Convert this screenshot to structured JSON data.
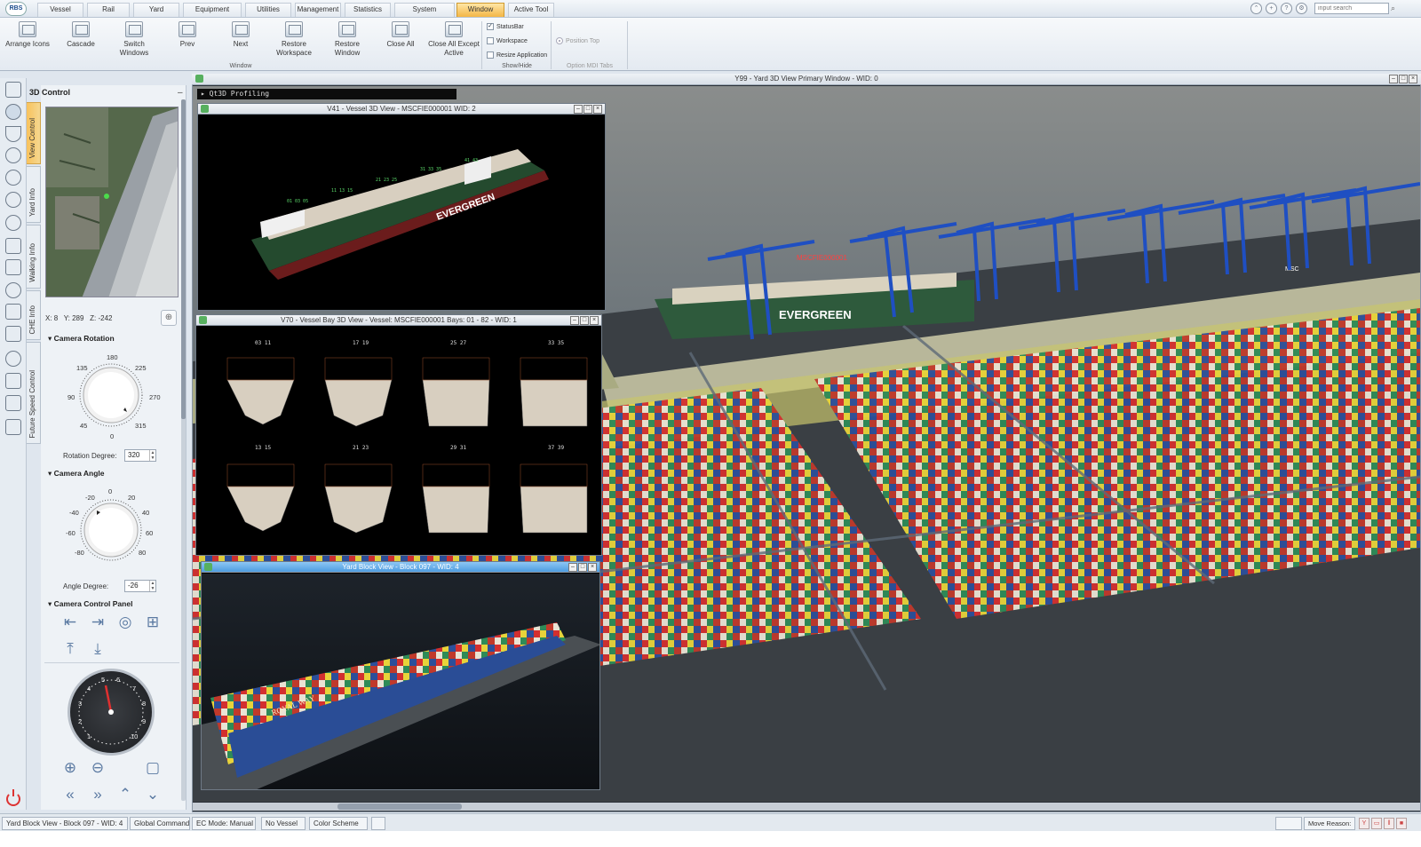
{
  "menu": {
    "logo": "RBS",
    "tabs": [
      "Vessel",
      "Rail",
      "Yard",
      "Equipment Control",
      "Utilities",
      "Management",
      "Statistics",
      "System References",
      "Window",
      "Active Tool"
    ],
    "active_tab": "Window",
    "search_placeholder": "input search"
  },
  "ribbon": {
    "buttons": [
      {
        "label": "Arrange Icons"
      },
      {
        "label": "Cascade"
      },
      {
        "label": "Switch Windows"
      },
      {
        "label": "Prev"
      },
      {
        "label": "Next"
      },
      {
        "label": "Restore Workspace"
      },
      {
        "label": "Restore Window"
      },
      {
        "label": "Close All"
      },
      {
        "label": "Close All Except Active"
      }
    ],
    "window_group_label": "Window",
    "show_hide": {
      "items": [
        {
          "label": "StatusBar",
          "checked": true
        },
        {
          "label": "Workspace",
          "checked": false
        },
        {
          "label": "Resize Application",
          "checked": false
        }
      ],
      "group_label": "Show/Hide"
    },
    "option_mdi": {
      "item": "Position Top",
      "group_label": "Option MDI Tabs"
    }
  },
  "side_tabs": [
    "View Control",
    "Yard Info",
    "Walking Info",
    "CHE Info",
    "Future Speed Control"
  ],
  "control_panel": {
    "title": "3D Control",
    "coords": {
      "x": "X: 8",
      "y": "Y: 289",
      "z": "Z: -242"
    },
    "camera_rotation": {
      "title": "Camera Rotation",
      "dial_labels": [
        "180",
        "135",
        "225",
        "90",
        "270",
        "45",
        "315",
        "0"
      ],
      "degree_label": "Rotation Degree:",
      "degree_value": "320"
    },
    "camera_angle": {
      "title": "Camera Angle",
      "dial_labels": [
        "0",
        "-20",
        "20",
        "-40",
        "40",
        "-60",
        "60",
        "-80",
        "80"
      ],
      "degree_label": "Angle Degree:",
      "degree_value": "-26"
    },
    "camera_control_panel": {
      "title": "Camera Control Panel"
    },
    "speed_gauge_labels": [
      "5",
      "6",
      "4",
      "7",
      "3",
      "8",
      "2",
      "9",
      "1",
      "10"
    ]
  },
  "windows": {
    "main_title": "Y99 - Yard 3D View Primary Window - WID: 0",
    "profiling": "Qt3D Profiling",
    "vessel_view": {
      "title": "V41 - Vessel 3D View - MSCFIE000001 WID: 2",
      "hull_text": "EVERGREEN"
    },
    "bay_view": {
      "title": "V70 - Vessel Bay 3D View - Vessel: MSCFIE000001 Bays: 01 - 82 - WID: 1",
      "bay_labels": [
        "03 11",
        "17 19",
        "25 27",
        "33 35",
        "13 15",
        "21 23",
        "29 31",
        "37 39"
      ]
    },
    "block_view": {
      "title": "Yard Block View - Block 097 - WID: 4",
      "container_text": "ROYAL WAY"
    },
    "scene_text": {
      "ship": "EVERGREEN",
      "ship_tag": "MSCFIE000001",
      "crane_tag": "MSC"
    }
  },
  "statusbar": {
    "cells": [
      "Yard Block View - Block 097 - WID: 4",
      "Global Command",
      "EC Mode: Manual",
      "No Vessel",
      "Color Scheme"
    ],
    "move_reason_label": "Move Reason:"
  }
}
